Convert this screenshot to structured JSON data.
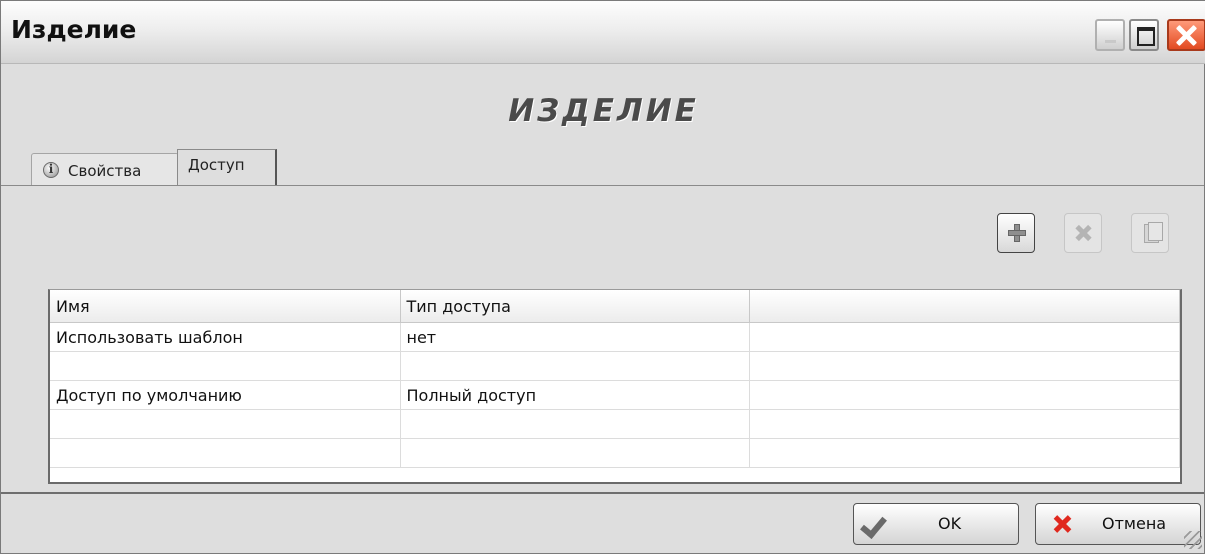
{
  "window": {
    "title": "Изделие",
    "controls": [
      "minimize-icon",
      "maximize-icon",
      "close-icon"
    ]
  },
  "header_label": "ИЗДЕЛИЕ",
  "tabs": [
    {
      "label": "Свойства",
      "icon": "info-icon",
      "active": false
    },
    {
      "label": "Доступ",
      "active": true
    }
  ],
  "toolbar": {
    "buttons": [
      {
        "name": "add",
        "icon": "plus-icon",
        "enabled": true
      },
      {
        "name": "delete",
        "icon": "delete-x-icon",
        "enabled": false
      },
      {
        "name": "properties",
        "icon": "properties-icon",
        "enabled": false
      }
    ]
  },
  "grid": {
    "columns": [
      "Имя",
      "Тип доступа",
      ""
    ],
    "rows": [
      [
        "Использовать шаблон",
        "нет",
        ""
      ],
      [
        "",
        "",
        ""
      ],
      [
        "Доступ по умолчанию",
        "Полный доступ",
        ""
      ],
      [
        "",
        "",
        ""
      ],
      [
        "",
        "",
        ""
      ]
    ]
  },
  "footer": {
    "ok_label": "OK",
    "cancel_label": "Отмена"
  },
  "colors": {
    "window_bg": "#dedede",
    "close_button": "#e24a21",
    "cancel_icon": "#e0281e"
  }
}
